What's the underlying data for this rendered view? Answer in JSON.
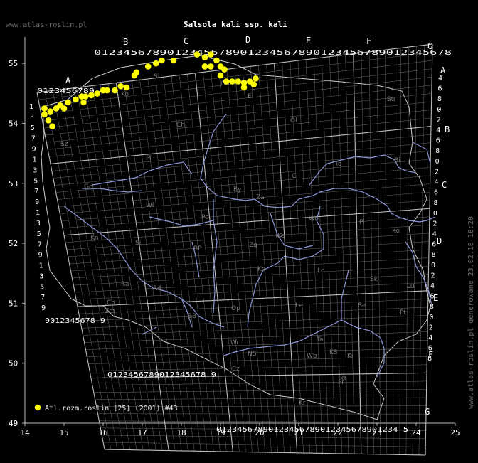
{
  "header": {
    "site": "www.atlas-roslin.pl",
    "title": "Salsola kali ssp. kali"
  },
  "side_text": "www.atlas-roslin.pl generowane 23.02.18 18:20",
  "legend": {
    "label": "Atl.rozm.roslin [25] (2001) #43",
    "color": "#ffff00"
  },
  "axes": {
    "x_ticks": [
      "14",
      "15",
      "16",
      "17",
      "18",
      "19",
      "20",
      "21",
      "22",
      "23",
      "24",
      "25"
    ],
    "y_ticks": [
      "49",
      "50",
      "51",
      "52",
      "53",
      "54",
      "55"
    ]
  },
  "grid_letters": {
    "top": [
      "A",
      "B",
      "C",
      "D",
      "E",
      "F",
      "G"
    ],
    "right": [
      "A",
      "B",
      "C",
      "D",
      "E",
      "F",
      "G"
    ]
  },
  "grid_digits": {
    "top_row_1": "0123456789012345678901234567890123456789012345678",
    "row_A": "0123456789",
    "left_col": [
      "1",
      "3",
      "5",
      "7",
      "9",
      "1",
      "3",
      "5",
      "7",
      "9",
      "1",
      "3",
      "5",
      "7",
      "9",
      "1",
      "3",
      "5",
      "7",
      "9"
    ],
    "bottom_left": "9012345678 9",
    "bottom_mid": "0123456789012345678 9",
    "bottom": "01234567890123456789012345678901234 5",
    "right_col": [
      "4",
      "6",
      "8",
      "0",
      "2",
      "4",
      "6",
      "8",
      "0",
      "2",
      "4",
      "6",
      "8",
      "0",
      "2",
      "4",
      "6",
      "8",
      "0",
      "2",
      "4",
      "6",
      "8",
      "0",
      "2",
      "4",
      "6",
      "8"
    ]
  },
  "regions": [
    "Sz",
    "Ko",
    "Ch",
    "Sl",
    "Gd",
    "El",
    "Ol",
    "Su",
    "Pi",
    "Go",
    "By",
    "To",
    "Ci",
    "Bi",
    "Wl",
    "Za",
    "Wo",
    "Po",
    "Kn",
    "Pl",
    "Lo",
    "Ko",
    "Si",
    "BP",
    "Zg",
    "Le",
    "Ka",
    "Ld",
    "Sk",
    "Lu",
    "Pt",
    "Ra",
    "Rd",
    "Ch",
    "Zm",
    "Le",
    "Wr",
    "Op",
    "Wb",
    "Ki",
    "Kt",
    "Ta",
    "Cz",
    "Kr",
    "Tr",
    "Pr",
    "Be",
    "BB",
    "NS",
    "KS"
  ],
  "chart_data": {
    "type": "scatter",
    "title": "Salsola kali ssp. kali",
    "xlabel": "",
    "ylabel": "",
    "xlim": [
      14,
      25
    ],
    "ylim": [
      49,
      55.5
    ],
    "series": [
      {
        "name": "Atl.rozm.roslin [25] (2001) #43",
        "points": [
          [
            14.5,
            54.25
          ],
          [
            14.5,
            54.15
          ],
          [
            14.6,
            54.05
          ],
          [
            14.7,
            53.95
          ],
          [
            14.65,
            54.2
          ],
          [
            14.8,
            54.25
          ],
          [
            14.9,
            54.3
          ],
          [
            15.0,
            54.25
          ],
          [
            15.1,
            54.35
          ],
          [
            15.3,
            54.4
          ],
          [
            15.45,
            54.45
          ],
          [
            15.55,
            54.45
          ],
          [
            15.7,
            54.47
          ],
          [
            15.5,
            54.35
          ],
          [
            15.85,
            54.5
          ],
          [
            16.0,
            54.55
          ],
          [
            16.1,
            54.55
          ],
          [
            16.3,
            54.55
          ],
          [
            16.45,
            54.62
          ],
          [
            16.6,
            54.6
          ],
          [
            16.8,
            54.8
          ],
          [
            16.85,
            54.85
          ],
          [
            17.15,
            54.95
          ],
          [
            17.35,
            55.0
          ],
          [
            17.5,
            55.05
          ],
          [
            17.8,
            55.05
          ],
          [
            18.4,
            55.15
          ],
          [
            18.6,
            55.1
          ],
          [
            18.75,
            55.15
          ],
          [
            18.9,
            55.05
          ],
          [
            18.75,
            54.95
          ],
          [
            18.6,
            54.95
          ],
          [
            19.0,
            54.95
          ],
          [
            19.1,
            54.9
          ],
          [
            19.0,
            54.8
          ],
          [
            19.15,
            54.7
          ],
          [
            19.3,
            54.7
          ],
          [
            19.45,
            54.7
          ],
          [
            19.6,
            54.68
          ],
          [
            19.75,
            54.7
          ],
          [
            19.9,
            54.75
          ],
          [
            19.6,
            54.6
          ],
          [
            19.85,
            54.65
          ]
        ]
      }
    ],
    "grid": true
  }
}
